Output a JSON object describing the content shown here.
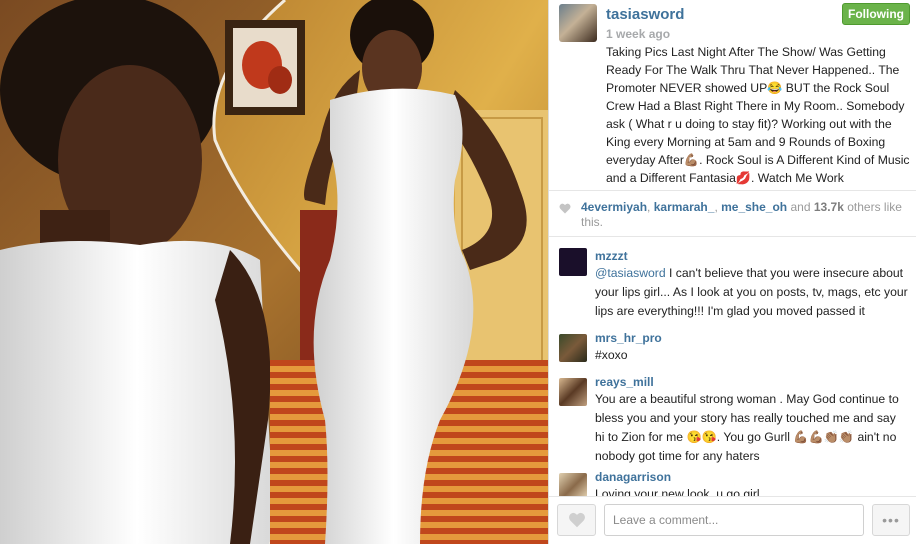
{
  "post": {
    "owner": "tasiasword",
    "time": "1 week ago",
    "follow_label": "Following",
    "caption": "Taking Pics Last Night After The Show/ Was Getting Ready For The Walk Thru That Never Happened.. The Promoter NEVER showed UP😂 BUT the Rock Soul Crew Had a Blast Right There in My Room.. Somebody ask ( What r u doing to stay fit)? Working out with the King every Morning at 5am and 9 Rounds of Boxing everyday After💪🏽. Rock Soul is A Different Kind of Music and a Different Fantasia💋. Watch Me Work"
  },
  "likes": {
    "users": [
      "4evermiyah",
      "karmarah_",
      "me_she_oh"
    ],
    "and_text": "and",
    "count": "13.7k",
    "suffix": "others like this."
  },
  "comments": [
    {
      "user": "mzzzt",
      "mention": "@tasiasword",
      "text": " I can't believe that you were insecure about your lips girl... As I look at you on posts, tv, mags, etc your lips are everything!!! I'm glad you moved passed it"
    },
    {
      "user": "mrs_hr_pro",
      "mention": "",
      "text": "#xoxo"
    },
    {
      "user": "reays_mill",
      "mention": "",
      "text": "You are a beautiful strong woman . May God continue to bless you and your story has really touched me and say hi to Zion for me 😘😘. You go Gurll 💪🏽💪🏽👏🏽👏🏽 ain't no nobody got time for any haters"
    },
    {
      "user": "danagarrison",
      "mention": "",
      "text": "Loving your new look, u go girl"
    }
  ],
  "footer": {
    "comment_placeholder": "Leave a comment...",
    "more_label": "•••"
  },
  "colors": {
    "username": "#3f729b",
    "follow_green": "#6bb34a",
    "muted": "#a7a9ab"
  },
  "icons": {
    "likes_heart": "heart-icon",
    "like_button": "heart-icon",
    "more": "ellipsis-icon"
  }
}
